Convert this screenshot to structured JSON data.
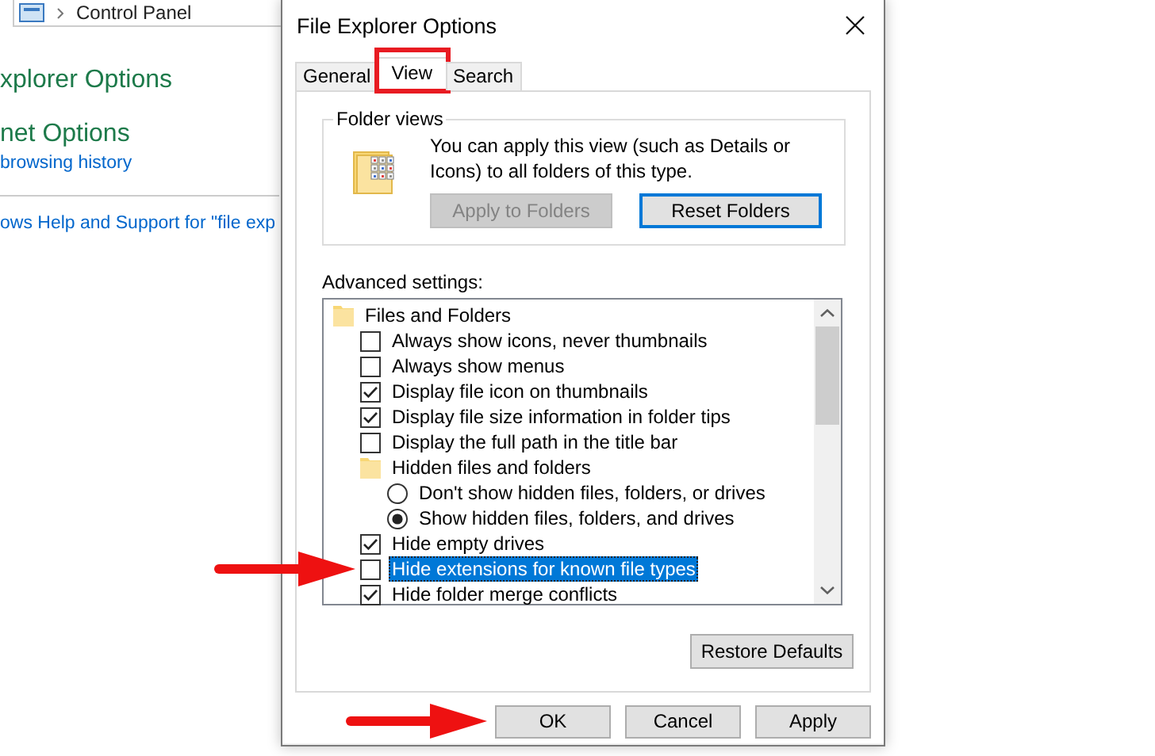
{
  "control_panel": {
    "breadcrumb": "Control Panel",
    "sections": [
      {
        "title": "xplorer Options"
      },
      {
        "title": "net Options",
        "links": [
          "browsing history"
        ]
      }
    ],
    "help_link": "ows Help and Support for \"file exp"
  },
  "dialog": {
    "title": "File Explorer Options",
    "tabs": [
      {
        "label": "General",
        "selected": false,
        "highlighted": false
      },
      {
        "label": "View",
        "selected": true,
        "highlighted": true
      },
      {
        "label": "Search",
        "selected": false,
        "highlighted": false
      }
    ],
    "folder_views": {
      "legend": "Folder views",
      "description": "You can apply this view (such as Details or Icons) to all folders of this type.",
      "buttons": [
        {
          "label": "Apply to Folders",
          "disabled": true,
          "focused": false
        },
        {
          "label": "Reset Folders",
          "disabled": false,
          "focused": true
        }
      ]
    },
    "advanced": {
      "label": "Advanced settings:",
      "tree": [
        {
          "kind": "folder",
          "label": "Files and Folders",
          "selected": false,
          "pointed": false,
          "children": [
            {
              "kind": "checkbox",
              "label": "Always show icons, never thumbnails",
              "checked": false,
              "selected": false,
              "pointed": false
            },
            {
              "kind": "checkbox",
              "label": "Always show menus",
              "checked": false,
              "selected": false,
              "pointed": false
            },
            {
              "kind": "checkbox",
              "label": "Display file icon on thumbnails",
              "checked": true,
              "selected": false,
              "pointed": false
            },
            {
              "kind": "checkbox",
              "label": "Display file size information in folder tips",
              "checked": true,
              "selected": false,
              "pointed": false
            },
            {
              "kind": "checkbox",
              "label": "Display the full path in the title bar",
              "checked": false,
              "selected": false,
              "pointed": false
            },
            {
              "kind": "folder",
              "label": "Hidden files and folders",
              "selected": false,
              "pointed": false,
              "children": [
                {
                  "kind": "radio",
                  "label": "Don't show hidden files, folders, or drives",
                  "checked": false,
                  "selected": false,
                  "pointed": false
                },
                {
                  "kind": "radio",
                  "label": "Show hidden files, folders, and drives",
                  "checked": true,
                  "selected": false,
                  "pointed": false
                }
              ]
            },
            {
              "kind": "checkbox",
              "label": "Hide empty drives",
              "checked": true,
              "selected": false,
              "pointed": false
            },
            {
              "kind": "checkbox",
              "label": "Hide extensions for known file types",
              "checked": false,
              "selected": true,
              "pointed": true
            },
            {
              "kind": "checkbox",
              "label": "Hide folder merge conflicts",
              "checked": true,
              "selected": false,
              "pointed": false
            }
          ]
        }
      ]
    },
    "restore_button": "Restore Defaults",
    "buttons": [
      {
        "label": "OK",
        "pointed": true
      },
      {
        "label": "Cancel",
        "pointed": false
      },
      {
        "label": "Apply",
        "pointed": false
      }
    ]
  }
}
